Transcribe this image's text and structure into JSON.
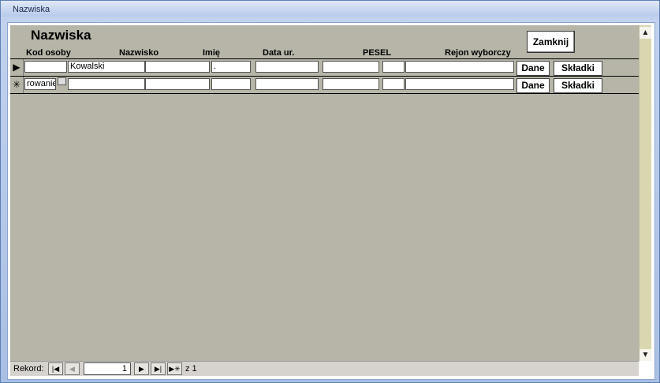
{
  "window": {
    "title": "Nazwiska"
  },
  "form": {
    "heading": "Nazwiska",
    "close_label": "Zamknij",
    "columns": [
      "Kod osoby",
      "Nazwisko",
      "Imię",
      "Data ur.",
      "PESEL",
      "Rejon wyborczy"
    ]
  },
  "rows": [
    {
      "selector": "▶",
      "kod": "",
      "nazwisko": "Kowalski",
      "imie": ".",
      "data": "",
      "pesel": "",
      "rejon": "",
      "dane": "Dane",
      "skladki": "Składki"
    },
    {
      "selector": "✳",
      "kod": "rowanie)",
      "nazwisko": "",
      "imie": "",
      "data": "",
      "pesel": "",
      "rejon": "",
      "dane": "Dane",
      "skladki": "Składki"
    }
  ],
  "navigation": {
    "label": "Rekord:",
    "current": "1",
    "of_text": "z 1"
  },
  "scrollbar": {
    "up": "▲",
    "down": "▼"
  }
}
